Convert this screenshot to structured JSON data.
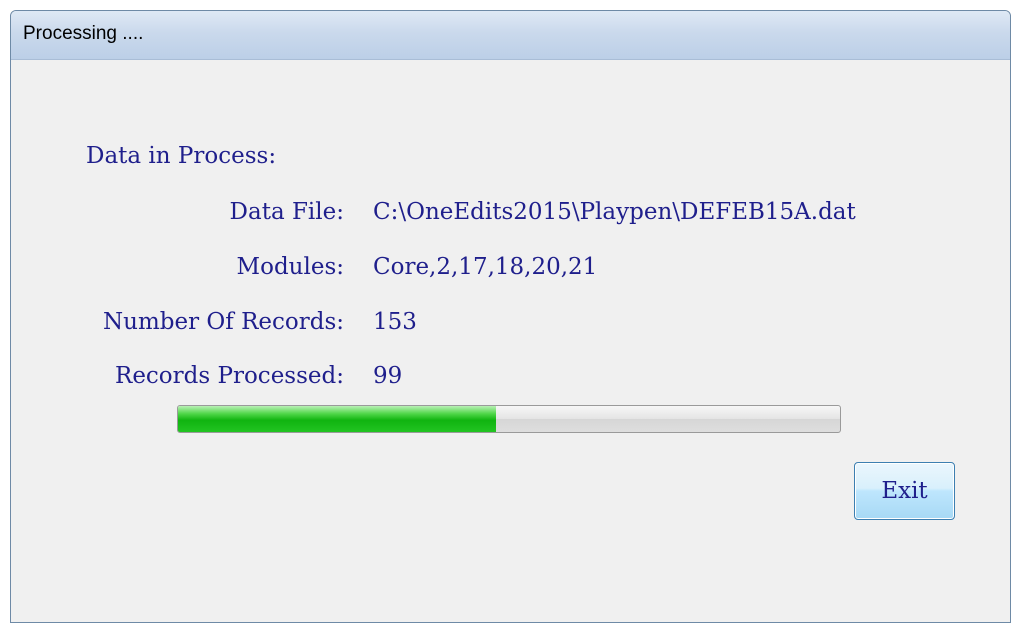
{
  "window": {
    "title": "Processing ...."
  },
  "main": {
    "heading": "Data in Process:",
    "fields": [
      {
        "label": "Data File:",
        "value": "C:\\OneEdits2015\\Playpen\\DEFEB15A.dat"
      },
      {
        "label": "Modules:",
        "value": "Core,2,17,18,20,21"
      },
      {
        "label": "Number Of Records:",
        "value": "153"
      },
      {
        "label": "Records Processed:",
        "value": "99"
      }
    ],
    "progress": {
      "fraction": 0.48,
      "fill_color": "#10b410"
    }
  },
  "buttons": {
    "exit_label": "Exit"
  }
}
